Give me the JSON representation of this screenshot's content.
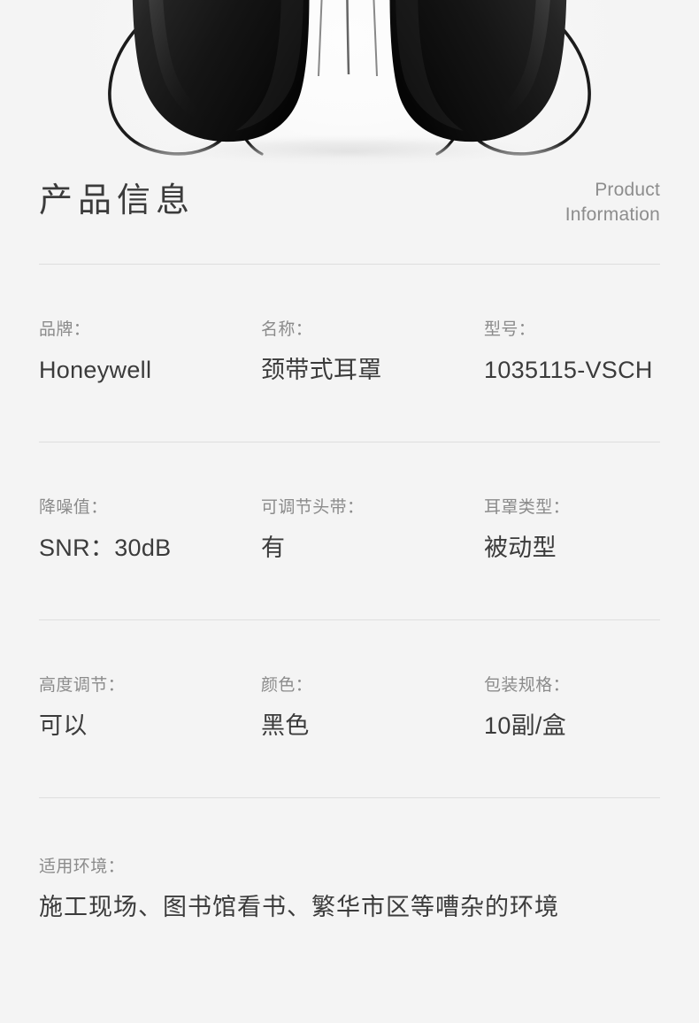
{
  "page": {
    "background_color": "#f4f4f4",
    "title_color": "#3b3b3b",
    "label_color": "#8b8b8b",
    "divider_color": "#dedede"
  },
  "hero": {
    "alt": "black neckband earmuffs product photo"
  },
  "section": {
    "title": "产品信息",
    "title_en_line1": "Product",
    "title_en_line2": "Information"
  },
  "specs": [
    {
      "cells": [
        {
          "label": "品牌：",
          "value": "Honeywell"
        },
        {
          "label": "名称：",
          "value": "颈带式耳罩"
        },
        {
          "label": "型号：",
          "value": "1035115-VSCH"
        }
      ]
    },
    {
      "cells": [
        {
          "label": "降噪值：",
          "value": "SNR：30dB"
        },
        {
          "label": "可调节头带：",
          "value": "有"
        },
        {
          "label": "耳罩类型：",
          "value": "被动型"
        }
      ]
    },
    {
      "cells": [
        {
          "label": "高度调节：",
          "value": "可以"
        },
        {
          "label": "颜色：",
          "value": "黑色"
        },
        {
          "label": "包装规格：",
          "value": "10副/盒"
        }
      ]
    }
  ],
  "environment": {
    "label": "适用环境：",
    "value": "施工现场、图书馆看书、繁华市区等嘈杂的环境"
  }
}
